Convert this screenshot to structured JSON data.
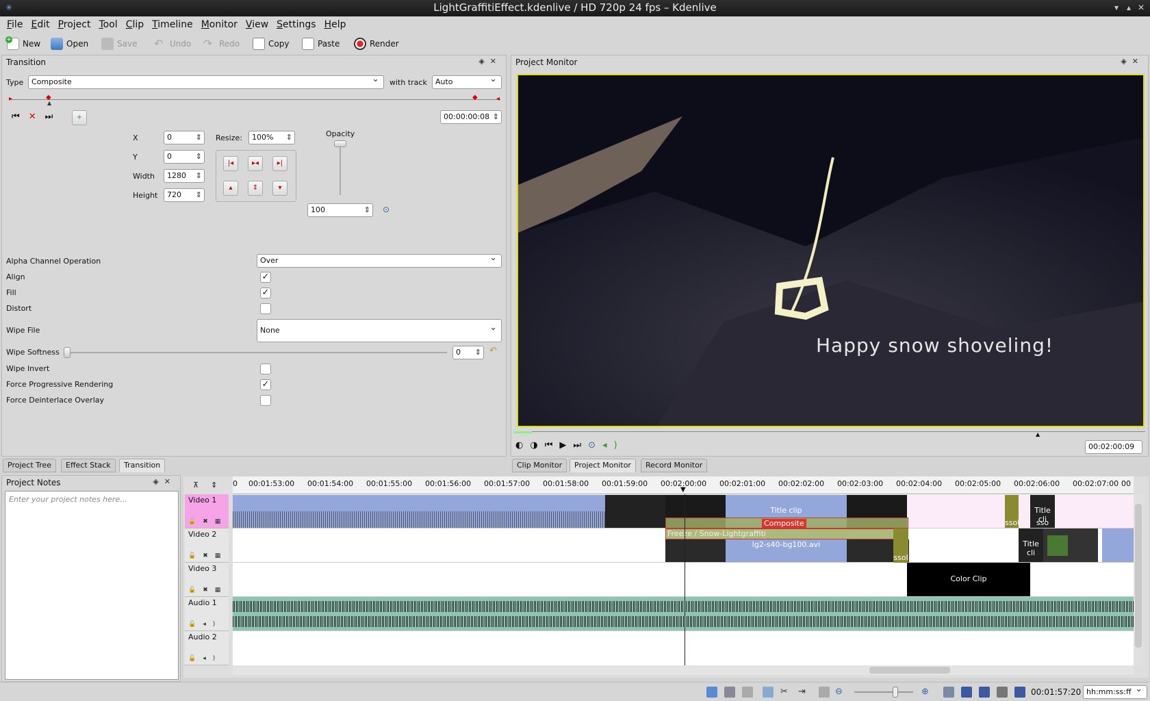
{
  "window": {
    "title": "LightGraffitiEffect.kdenlive / HD 720p 24 fps – Kdenlive"
  },
  "menu": [
    "File",
    "Edit",
    "Project",
    "Tool",
    "Clip",
    "Timeline",
    "Monitor",
    "View",
    "Settings",
    "Help"
  ],
  "toolbar": {
    "new": "New",
    "open": "Open",
    "save": "Save",
    "undo": "Undo",
    "redo": "Redo",
    "copy": "Copy",
    "paste": "Paste",
    "render": "Render"
  },
  "transition": {
    "panel_title": "Transition",
    "type_label": "Type",
    "type_value": "Composite",
    "with_track_label": "with track",
    "with_track_value": "Auto",
    "keyframe_time": "00:00:00:08",
    "x_label": "X",
    "x_value": "0",
    "y_label": "Y",
    "y_value": "0",
    "width_label": "Width",
    "width_value": "1280",
    "height_label": "Height",
    "height_value": "720",
    "resize_label": "Resize:",
    "resize_value": "100%",
    "opacity_label": "Opacity",
    "opacity_value": "100",
    "alpha_label": "Alpha Channel Operation",
    "alpha_value": "Over",
    "align_label": "Align",
    "align_checked": true,
    "fill_label": "Fill",
    "fill_checked": true,
    "distort_label": "Distort",
    "distort_checked": false,
    "wipe_file_label": "Wipe File",
    "wipe_file_value": "None",
    "wipe_softness_label": "Wipe Softness",
    "wipe_softness_value": "0",
    "wipe_invert_label": "Wipe Invert",
    "wipe_invert_checked": false,
    "force_prog_label": "Force Progressive Rendering",
    "force_prog_checked": true,
    "force_deint_label": "Force Deinterlace Overlay",
    "force_deint_checked": false
  },
  "left_tabs": [
    "Project Tree",
    "Effect Stack",
    "Transition"
  ],
  "monitor": {
    "panel_title": "Project Monitor",
    "overlay_text": "Happy snow shoveling!",
    "timecode": "00:02:00:09"
  },
  "monitor_tabs": [
    "Clip Monitor",
    "Project Monitor",
    "Record Monitor"
  ],
  "notes": {
    "title": "Project Notes",
    "placeholder": "Enter your project notes here..."
  },
  "timeline": {
    "ruler": [
      "00:01:53:00",
      "00:01:54:00",
      "00:01:55:00",
      "00:01:56:00",
      "00:01:57:00",
      "00:01:58:00",
      "00:01:59:00",
      "00:02:00:00",
      "00:02:01:00",
      "00:02:02:00",
      "00:02:03:00",
      "00:02:04:00",
      "00:02:05:00",
      "00:02:06:00",
      "00:02:07:00"
    ],
    "ruler_edge_left": "0",
    "ruler_edge_right": "00",
    "tracks": [
      "Video 1",
      "Video 2",
      "Video 3",
      "Audio 1",
      "Audio 2"
    ],
    "clips": {
      "title_clip": "Title clip",
      "composite": "Composite",
      "freeze": "Freeze / Snow-Lightgraffiti",
      "lg2": "lg2-s40-bg100.avi",
      "color_clip": "Color Clip",
      "title_cli_1": "Title cli",
      "title_cli_2": "Title cli",
      "dissolve_1": "ssolve",
      "dissolve_2": "ssol",
      "dissolve_3": "sso"
    }
  },
  "status": {
    "timecode": "00:01:57:20",
    "format": "hh:mm:ss:ff"
  },
  "colors": {
    "accent_pink": "#f6a3e8",
    "clip_blue": "#93a7da",
    "audio_green": "#8fc4b2",
    "transition_red": "#d9352d"
  }
}
